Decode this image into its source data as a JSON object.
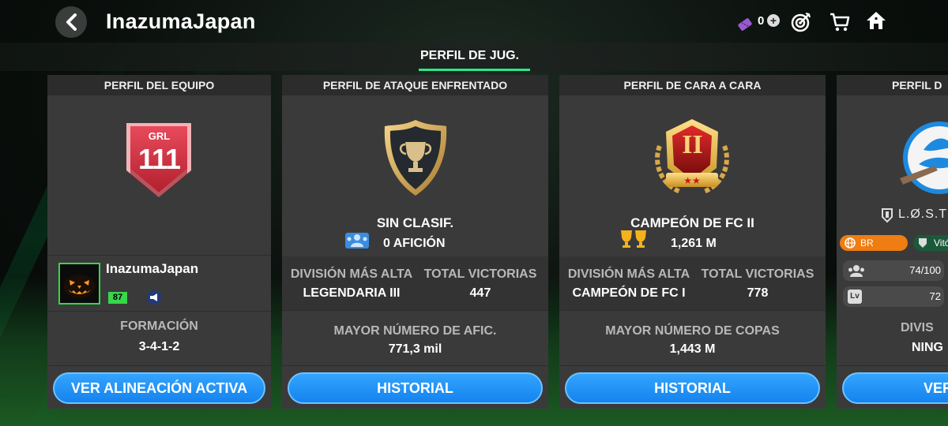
{
  "header": {
    "title": "InazumaJapan",
    "coin_count": "0",
    "icons": [
      "back-arrow-icon",
      "ticket-icon",
      "plus-icon",
      "target-icon",
      "cart-icon",
      "home-icon"
    ]
  },
  "tabs": {
    "active_label": "PERFIL DE JUG."
  },
  "colors": {
    "accent_green": "#2ee58a",
    "button_blue": "#1e90ff",
    "level_green": "#38d64a"
  },
  "team_card": {
    "header": "PERFIL DEL EQUIPO",
    "badge_label": "GRL",
    "badge_value": "111",
    "player_name": "InazumaJapan",
    "level": "87",
    "formation_label": "FORMACIÓN",
    "formation_value": "3-4-1-2",
    "button": "VER ALINEACIÓN ACTIVA"
  },
  "attack_card": {
    "header": "PERFIL DE ATAQUE ENFRENTADO",
    "rank": "SIN CLASIF.",
    "fans": "0 AFICIÓN",
    "stat1_label": "DIVISIÓN MÁS ALTA",
    "stat1_value": "LEGENDARIA III",
    "stat2_label": "TOTAL VICTORIAS",
    "stat2_value": "447",
    "record_label": "MAYOR NÚMERO DE AFIC.",
    "record_value": "771,3 mil",
    "button": "HISTORIAL"
  },
  "h2h_card": {
    "header": "PERFIL DE CARA A CARA",
    "badge_numeral": "II",
    "rank": "CAMPEÓN DE FC II",
    "trophies": "1,261 M",
    "stat1_label": "DIVISIÓN MÁS ALTA",
    "stat1_value": "CAMPEÓN DE FC I",
    "stat2_label": "TOTAL VICTORIAS",
    "stat2_value": "778",
    "record_label": "MAYOR NÚMERO DE COPAS",
    "record_value": "1,443 M",
    "button": "HISTORIAL"
  },
  "league_card": {
    "header": "PERFIL D",
    "league_name": "L.Ø.S.T",
    "country": "BR",
    "club_tag": "Vitó",
    "members": "74/100",
    "level": "72",
    "division_label": "DIVIS",
    "division_value": "NING",
    "button": "VER"
  }
}
